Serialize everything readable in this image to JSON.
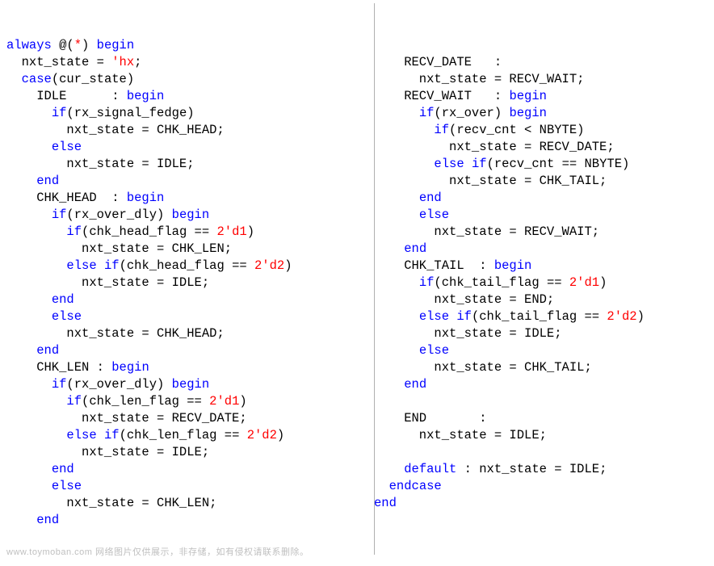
{
  "watermark": "www.toymoban.com 网络图片仅供展示，非存储，如有侵权请联系删除。",
  "code": {
    "left": [
      [
        [
          "kw",
          "always"
        ],
        [
          "id",
          " @("
        ],
        [
          "num",
          "*"
        ],
        [
          "id",
          ") "
        ],
        [
          "kw",
          "begin"
        ]
      ],
      [
        [
          "id",
          "  nxt_state = "
        ],
        [
          "num",
          "'hx"
        ],
        [
          "id",
          ";"
        ]
      ],
      [
        [
          "id",
          "  "
        ],
        [
          "kw",
          "case"
        ],
        [
          "id",
          "(cur_state)"
        ]
      ],
      [
        [
          "id",
          "    IDLE      : "
        ],
        [
          "kw",
          "begin"
        ]
      ],
      [
        [
          "id",
          "      "
        ],
        [
          "kw",
          "if"
        ],
        [
          "id",
          "(rx_signal_fedge)"
        ]
      ],
      [
        [
          "id",
          "        nxt_state = CHK_HEAD;"
        ]
      ],
      [
        [
          "id",
          "      "
        ],
        [
          "kw",
          "else"
        ]
      ],
      [
        [
          "id",
          "        nxt_state = IDLE;"
        ]
      ],
      [
        [
          "id",
          "    "
        ],
        [
          "kw",
          "end"
        ]
      ],
      [
        [
          "id",
          "    CHK_HEAD  : "
        ],
        [
          "kw",
          "begin"
        ]
      ],
      [
        [
          "id",
          "      "
        ],
        [
          "kw",
          "if"
        ],
        [
          "id",
          "(rx_over_dly) "
        ],
        [
          "kw",
          "begin"
        ]
      ],
      [
        [
          "id",
          "        "
        ],
        [
          "kw",
          "if"
        ],
        [
          "id",
          "(chk_head_flag == "
        ],
        [
          "num",
          "2'd1"
        ],
        [
          "id",
          ")"
        ]
      ],
      [
        [
          "id",
          "          nxt_state = CHK_LEN;"
        ]
      ],
      [
        [
          "id",
          "        "
        ],
        [
          "kw",
          "else"
        ],
        [
          "id",
          " "
        ],
        [
          "kw",
          "if"
        ],
        [
          "id",
          "(chk_head_flag == "
        ],
        [
          "num",
          "2'd2"
        ],
        [
          "id",
          ")"
        ]
      ],
      [
        [
          "id",
          "          nxt_state = IDLE;"
        ]
      ],
      [
        [
          "id",
          "      "
        ],
        [
          "kw",
          "end"
        ]
      ],
      [
        [
          "id",
          "      "
        ],
        [
          "kw",
          "else"
        ]
      ],
      [
        [
          "id",
          "        nxt_state = CHK_HEAD;"
        ]
      ],
      [
        [
          "id",
          "    "
        ],
        [
          "kw",
          "end"
        ]
      ],
      [
        [
          "id",
          "    CHK_LEN : "
        ],
        [
          "kw",
          "begin"
        ]
      ],
      [
        [
          "id",
          "      "
        ],
        [
          "kw",
          "if"
        ],
        [
          "id",
          "(rx_over_dly) "
        ],
        [
          "kw",
          "begin"
        ]
      ],
      [
        [
          "id",
          "        "
        ],
        [
          "kw",
          "if"
        ],
        [
          "id",
          "(chk_len_flag == "
        ],
        [
          "num",
          "2'd1"
        ],
        [
          "id",
          ")"
        ]
      ],
      [
        [
          "id",
          "          nxt_state = RECV_DATE;"
        ]
      ],
      [
        [
          "id",
          "        "
        ],
        [
          "kw",
          "else"
        ],
        [
          "id",
          " "
        ],
        [
          "kw",
          "if"
        ],
        [
          "id",
          "(chk_len_flag == "
        ],
        [
          "num",
          "2'd2"
        ],
        [
          "id",
          ")"
        ]
      ],
      [
        [
          "id",
          "          nxt_state = IDLE;"
        ]
      ],
      [
        [
          "id",
          "      "
        ],
        [
          "kw",
          "end"
        ]
      ],
      [
        [
          "id",
          "      "
        ],
        [
          "kw",
          "else"
        ]
      ],
      [
        [
          "id",
          "        nxt_state = CHK_LEN;"
        ]
      ],
      [
        [
          "id",
          "    "
        ],
        [
          "kw",
          "end"
        ]
      ]
    ],
    "right": [
      [
        [
          "id",
          "    RECV_DATE   :"
        ]
      ],
      [
        [
          "id",
          "      nxt_state = RECV_WAIT;"
        ]
      ],
      [
        [
          "id",
          "    RECV_WAIT   : "
        ],
        [
          "kw",
          "begin"
        ]
      ],
      [
        [
          "id",
          "      "
        ],
        [
          "kw",
          "if"
        ],
        [
          "id",
          "(rx_over) "
        ],
        [
          "kw",
          "begin"
        ]
      ],
      [
        [
          "id",
          "        "
        ],
        [
          "kw",
          "if"
        ],
        [
          "id",
          "(recv_cnt < NBYTE)"
        ]
      ],
      [
        [
          "id",
          "          nxt_state = RECV_DATE;"
        ]
      ],
      [
        [
          "id",
          "        "
        ],
        [
          "kw",
          "else"
        ],
        [
          "id",
          " "
        ],
        [
          "kw",
          "if"
        ],
        [
          "id",
          "(recv_cnt == NBYTE)"
        ]
      ],
      [
        [
          "id",
          "          nxt_state = CHK_TAIL;"
        ]
      ],
      [
        [
          "id",
          "      "
        ],
        [
          "kw",
          "end"
        ]
      ],
      [
        [
          "id",
          "      "
        ],
        [
          "kw",
          "else"
        ]
      ],
      [
        [
          "id",
          "        nxt_state = RECV_WAIT;"
        ]
      ],
      [
        [
          "id",
          "    "
        ],
        [
          "kw",
          "end"
        ]
      ],
      [
        [
          "id",
          "    CHK_TAIL  : "
        ],
        [
          "kw",
          "begin"
        ]
      ],
      [
        [
          "id",
          "      "
        ],
        [
          "kw",
          "if"
        ],
        [
          "id",
          "(chk_tail_flag == "
        ],
        [
          "num",
          "2'd1"
        ],
        [
          "id",
          ")"
        ]
      ],
      [
        [
          "id",
          "        nxt_state = END;"
        ]
      ],
      [
        [
          "id",
          "      "
        ],
        [
          "kw",
          "else"
        ],
        [
          "id",
          " "
        ],
        [
          "kw",
          "if"
        ],
        [
          "id",
          "(chk_tail_flag == "
        ],
        [
          "num",
          "2'd2"
        ],
        [
          "id",
          ")"
        ]
      ],
      [
        [
          "id",
          "        nxt_state = IDLE;"
        ]
      ],
      [
        [
          "id",
          "      "
        ],
        [
          "kw",
          "else"
        ]
      ],
      [
        [
          "id",
          "        nxt_state = CHK_TAIL;"
        ]
      ],
      [
        [
          "id",
          "    "
        ],
        [
          "kw",
          "end"
        ]
      ],
      [
        [
          "id",
          ""
        ]
      ],
      [
        [
          "id",
          "    END       :"
        ]
      ],
      [
        [
          "id",
          "      nxt_state = IDLE;"
        ]
      ],
      [
        [
          "id",
          ""
        ]
      ],
      [
        [
          "id",
          "    "
        ],
        [
          "kw",
          "default"
        ],
        [
          "id",
          " : nxt_state = IDLE;"
        ]
      ],
      [
        [
          "id",
          "  "
        ],
        [
          "kw",
          "endcase"
        ]
      ],
      [
        [
          "kw",
          "end"
        ]
      ]
    ]
  }
}
